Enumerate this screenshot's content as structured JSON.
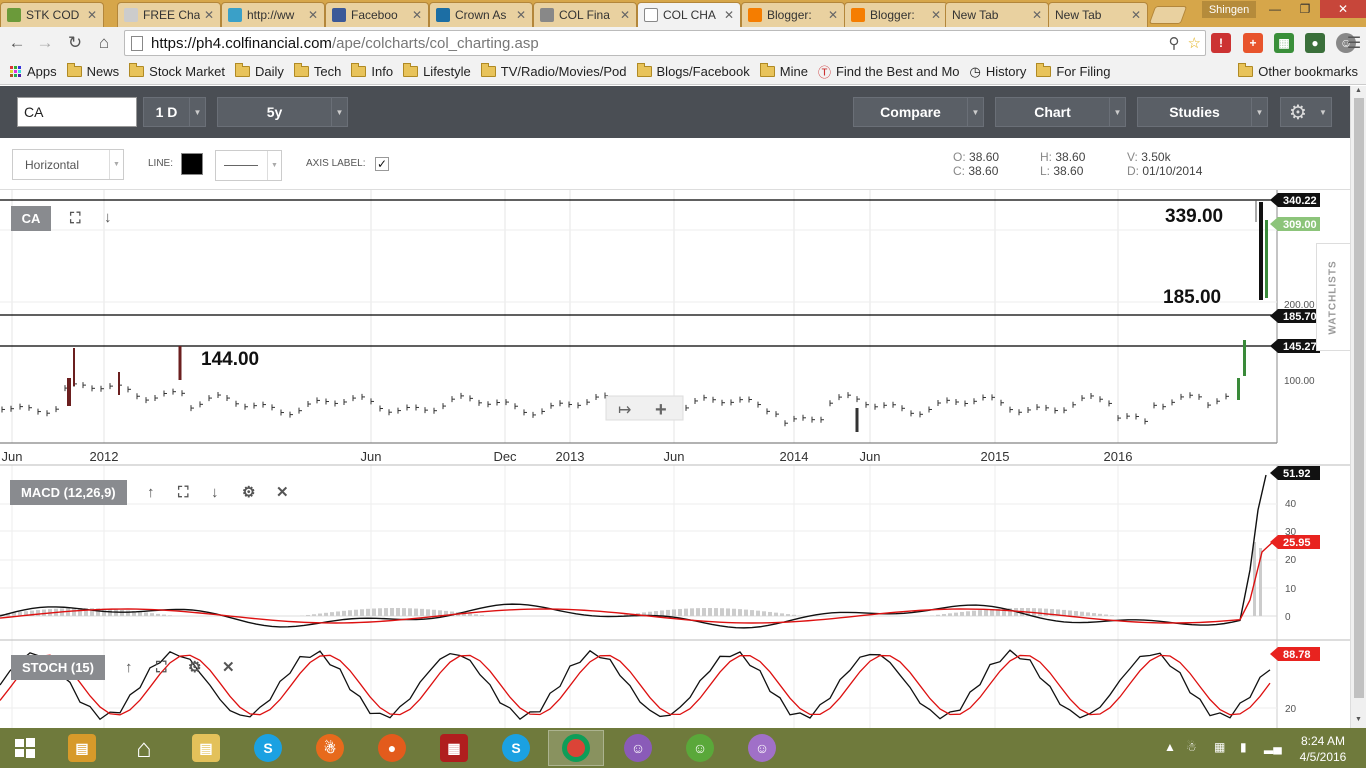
{
  "browser": {
    "tabs": [
      {
        "label": "STK COD",
        "icon": "page-icon",
        "color": "#6b9a3a"
      },
      {
        "label": "FREE Cha",
        "icon": "page-icon",
        "color": "#cccccc"
      },
      {
        "label": "http://ww",
        "icon": "chat-icon",
        "color": "#3aa0c8"
      },
      {
        "label": "Faceboo",
        "icon": "facebook-icon",
        "color": "#3b5998"
      },
      {
        "label": "Crown As",
        "icon": "ing-icon",
        "color": "#1c6ea4"
      },
      {
        "label": "COL Fina",
        "icon": "col-icon",
        "color": "#888888"
      },
      {
        "label": "COL CHA",
        "icon": "page-icon",
        "color": "#ffffff"
      },
      {
        "label": "Blogger:",
        "icon": "blogger-icon",
        "color": "#f57d00"
      },
      {
        "label": "Blogger:",
        "icon": "blogger-icon",
        "color": "#f57d00"
      },
      {
        "label": "New Tab",
        "icon": "none",
        "color": ""
      },
      {
        "label": "New Tab",
        "icon": "none",
        "color": ""
      }
    ],
    "active_tab": 6,
    "user": "Shingen",
    "url_host": "https://ph4.colfinancial.com",
    "url_path": "/ape/colcharts/col_charting.asp",
    "bookmarks": [
      {
        "label": "Apps",
        "type": "apps"
      },
      {
        "label": "News",
        "type": "folder"
      },
      {
        "label": "Stock Market",
        "type": "folder"
      },
      {
        "label": "Daily",
        "type": "folder"
      },
      {
        "label": "Tech",
        "type": "folder"
      },
      {
        "label": "Info",
        "type": "folder"
      },
      {
        "label": "Lifestyle",
        "type": "folder"
      },
      {
        "label": "TV/Radio/Movies/Pod",
        "type": "folder"
      },
      {
        "label": "Blogs/Facebook",
        "type": "folder"
      },
      {
        "label": "Mine",
        "type": "folder"
      },
      {
        "label": "Find the Best and Mo",
        "type": "site"
      },
      {
        "label": "History",
        "type": "history"
      },
      {
        "label": "For Filing",
        "type": "folder"
      }
    ],
    "other_bookmarks": "Other bookmarks"
  },
  "toolbar": {
    "symbol": "CA",
    "interval": "1 D",
    "range": "5y",
    "compare": "Compare",
    "chart": "Chart",
    "studies": "Studies"
  },
  "drawing": {
    "orientation": "Horizontal",
    "line_label": "LINE:",
    "axis_label": "AXIS LABEL:",
    "axis_checked": "✓"
  },
  "ohlc": {
    "open_k": "O:",
    "open": "38.60",
    "close_k": "C:",
    "close": "38.60",
    "high_k": "H:",
    "high": "38.60",
    "low_k": "L:",
    "low": "38.60",
    "vol_k": "V:",
    "vol": "3.50k",
    "date_k": "D:",
    "date": "01/10/2014"
  },
  "panes": {
    "main_label": "CA",
    "macd_label": "MACD (12,26,9)",
    "stoch_label": "STOCH (15)",
    "watchlists": "WATCHLISTS"
  },
  "annotations": {
    "a339": "339.00",
    "a185": "185.00",
    "a144": "144.00"
  },
  "price_tags": {
    "hl1": "340.22",
    "cur": "309.00",
    "hl2": "185.70",
    "hl3": "145.27",
    "tick200": "200.00",
    "tick100": "100.00",
    "macd": "51.92",
    "signal": "25.95",
    "stoch": "88.78"
  },
  "x_labels": [
    "Jun",
    "2012",
    "Jun",
    "Dec",
    "2013",
    "Jun",
    "2014",
    "Jun",
    "2015",
    "2016"
  ],
  "macd_ticks": [
    "40",
    "30",
    "20",
    "10",
    "0"
  ],
  "stoch_ticks": [
    "20"
  ],
  "taskbar": {
    "time": "8:24 AM",
    "date": "4/5/2016"
  },
  "chart_data": {
    "type": "line",
    "title": "CA",
    "series": [
      {
        "name": "CA",
        "x": [
          "2011-06",
          "2011-10",
          "2012-01",
          "2012-04",
          "2012-06",
          "2012-09",
          "2012-12",
          "2013-03",
          "2013-06",
          "2013-09",
          "2014-01",
          "2014-03",
          "2014-06",
          "2014-09",
          "2015-01",
          "2015-06",
          "2015-10",
          "2016-01",
          "2016-02",
          "2016-03",
          "2016-04"
        ],
        "values": [
          12,
          45,
          18,
          28,
          14,
          12,
          8,
          6,
          10,
          4,
          2,
          4,
          10,
          8,
          10,
          5,
          3,
          3,
          12,
          60,
          309
        ]
      },
      {
        "name": "MACD (12,26,9)",
        "values": [
          0,
          5,
          7,
          3,
          0,
          2,
          0,
          -1,
          2,
          1,
          -2,
          -2,
          3,
          4,
          3,
          1,
          -1,
          -3,
          1,
          10,
          51.92
        ]
      },
      {
        "name": "STOCH (15)",
        "values": [
          60,
          90,
          30,
          65,
          20,
          85,
          35,
          60,
          25,
          80,
          15,
          55,
          70,
          40,
          85,
          30,
          70,
          20,
          55,
          95,
          88.78
        ]
      }
    ]
  }
}
